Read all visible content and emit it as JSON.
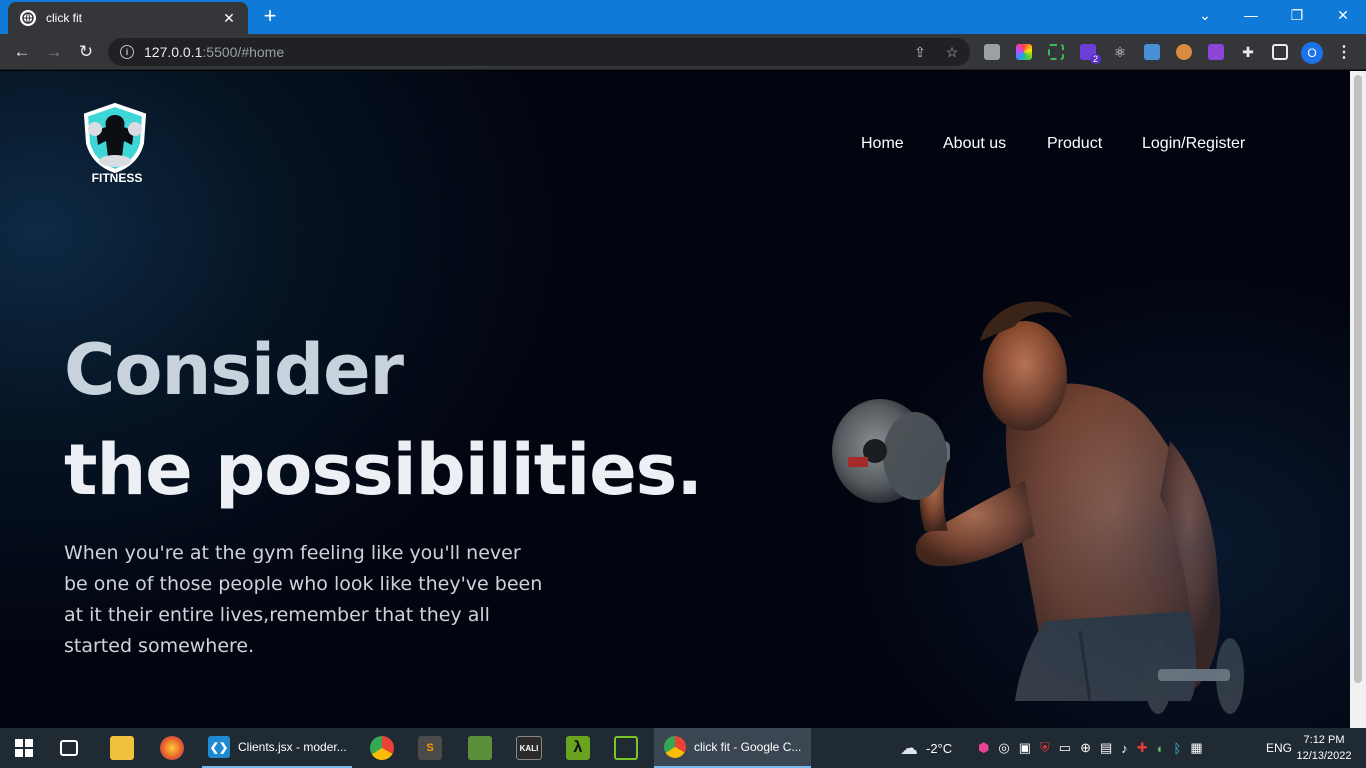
{
  "browser": {
    "tab_title": "click fit",
    "url_host": "127.0.0.1",
    "url_rest": ":5500/#home",
    "new_tab": "+",
    "profile_initial": "O",
    "extension_badge": "2"
  },
  "site": {
    "logo_text": "FITNESS",
    "nav": [
      "Home",
      "About us",
      "Product",
      "Login/Register"
    ],
    "hero_line1": "Consider",
    "hero_line2": "the possibilities.",
    "hero_text": "When you're at the gym feeling like you'll never be one of those people who look like they've been at it their entire lives,remember that they all started somewhere."
  },
  "taskbar": {
    "apps": [
      {
        "name": "vscode",
        "label": "Clients.jsx - moder..."
      },
      {
        "name": "chrome",
        "label": "click fit - Google C..."
      }
    ],
    "kali_label": "KALI",
    "weather": "-2°C",
    "language": "ENG",
    "time": "7:12 PM",
    "date": "12/13/2022"
  },
  "colors": {
    "tabbar": "#0f7ad8",
    "chrome_dark": "#35363a",
    "page_bg": "#020510",
    "accent_logo": "#3fd6d8"
  }
}
